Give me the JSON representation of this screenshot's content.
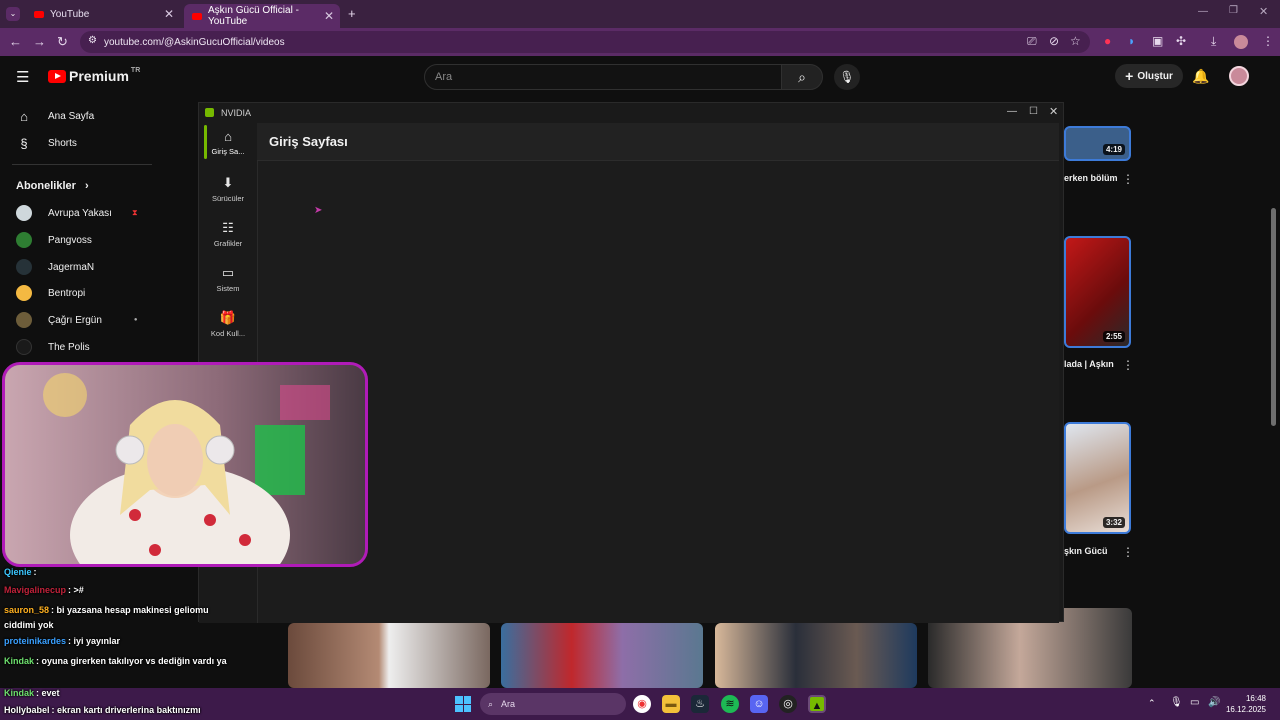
{
  "browser": {
    "tabs": [
      {
        "title": "YouTube"
      },
      {
        "title": "Aşkın Gücü Official - YouTube"
      }
    ],
    "url": "youtube.com/@AskinGucuOfficial/videos"
  },
  "youtube": {
    "logo_text": "Premium",
    "region": "TR",
    "search_placeholder": "Ara",
    "create_label": "Oluştur",
    "sidebar": {
      "main": [
        {
          "label": "Ana Sayfa",
          "icon": "home-icon"
        },
        {
          "label": "Shorts",
          "icon": "shorts-icon"
        }
      ],
      "subscriptions_heading": "Abonelikler",
      "subscriptions": [
        {
          "label": "Avrupa Yakası",
          "color": "#cfd8dc"
        },
        {
          "label": "Pangvoss",
          "color": "#2e7d32"
        },
        {
          "label": "JagermaN",
          "color": "#263238"
        },
        {
          "label": "Bentropi",
          "color": "#f4b942"
        },
        {
          "label": "Çağrı Ergün",
          "color": "#6d5d3a"
        },
        {
          "label": "The Polis",
          "color": "#1a1a1a"
        }
      ]
    },
    "videos": [
      {
        "duration": "4:19",
        "title_fragment": "erken bölüm"
      },
      {
        "duration": "2:55",
        "title_fragment": "lada | Aşkın"
      },
      {
        "duration": "3:32",
        "title_fragment": "şkın Gücü"
      }
    ]
  },
  "nvidia": {
    "window_title": "NVIDIA",
    "page_title": "Giriş Sayfası",
    "nav": [
      {
        "label": "Giriş Sa...",
        "icon": "home-icon",
        "active": true
      },
      {
        "label": "Sürücüler",
        "icon": "drivers-icon",
        "active": false
      },
      {
        "label": "Grafikler",
        "icon": "sliders-icon",
        "active": false
      },
      {
        "label": "Sistem",
        "icon": "system-icon",
        "active": false
      },
      {
        "label": "Kod Kull...",
        "icon": "gift-icon",
        "active": false
      }
    ],
    "accent": "#76b900"
  },
  "chat": [
    {
      "user": "Qienie",
      "text": "",
      "color": "#3cc7ff"
    },
    {
      "user": "Mavigalinecup",
      "text": ">#",
      "color": "#c0223a"
    },
    {
      "user": "sauron_58",
      "text": "bi yazsana hesap makinesi geliomu ciddimi yok",
      "color": "#ffb020"
    },
    {
      "user": "proteinikardes",
      "text": "iyi yayınlar",
      "color": "#3aa0ff"
    },
    {
      "user": "Kindak",
      "text": "oyuna girerken takılıyor vs dediğin vardı ya",
      "color": "#6ee06e"
    },
    {
      "user": "Kindak",
      "text": "evet",
      "color": "#6ee06e"
    },
    {
      "user": "Hollybabel",
      "text": "ekran kartı driverlerina baktınızmı",
      "color": "#ffffff"
    }
  ],
  "taskbar": {
    "search_placeholder": "Ara",
    "time": "16:48",
    "date": "16.12.2025"
  }
}
